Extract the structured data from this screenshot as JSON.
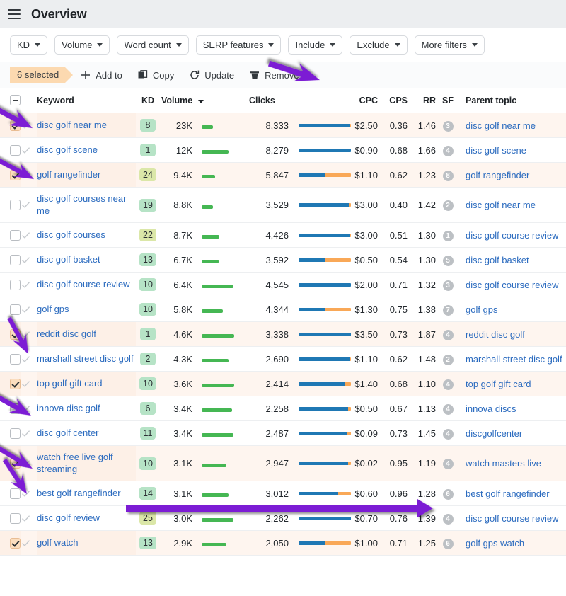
{
  "header": {
    "title": "Overview",
    "menu_icon": "hamburger-icon"
  },
  "filters": [
    {
      "label": "KD"
    },
    {
      "label": "Volume"
    },
    {
      "label": "Word count"
    },
    {
      "label": "SERP features"
    },
    {
      "label": "Include"
    },
    {
      "label": "Exclude"
    },
    {
      "label": "More filters"
    }
  ],
  "actionbar": {
    "selected_label": "6 selected",
    "add_to": "Add to",
    "copy": "Copy",
    "update": "Update",
    "remove": "Remove"
  },
  "table": {
    "columns": {
      "keyword": "Keyword",
      "kd": "KD",
      "volume": "Volume",
      "clicks": "Clicks",
      "cpc": "CPC",
      "cps": "CPS",
      "rr": "RR",
      "sf": "SF",
      "parent_topic": "Parent topic"
    },
    "sorted_by": "Volume",
    "rows": [
      {
        "selected": true,
        "keyword": "disc golf near me",
        "kd": 8,
        "kd_color": "#b6e3c6",
        "volume": "23K",
        "vol_pct": 26,
        "clicks": "8,333",
        "click_blue": 98,
        "click_orange": 2,
        "cpc": "$2.50",
        "cps": "0.36",
        "rr": "1.46",
        "sf": 3,
        "parent_topic": "disc golf near me"
      },
      {
        "selected": false,
        "keyword": "disc golf scene",
        "kd": 1,
        "kd_color": "#b6e3c6",
        "volume": "12K",
        "vol_pct": 62,
        "clicks": "8,279",
        "click_blue": 100,
        "click_orange": 0,
        "cpc": "$0.90",
        "cps": "0.68",
        "rr": "1.66",
        "sf": 4,
        "parent_topic": "disc golf scene"
      },
      {
        "selected": true,
        "keyword": "golf rangefinder",
        "kd": 24,
        "kd_color": "#dbe7a8",
        "volume": "9.4K",
        "vol_pct": 31,
        "clicks": "5,847",
        "click_blue": 50,
        "click_orange": 50,
        "cpc": "$1.10",
        "cps": "0.62",
        "rr": "1.23",
        "sf": 8,
        "parent_topic": "golf rangefinder"
      },
      {
        "selected": false,
        "keyword": "disc golf courses near me",
        "kd": 19,
        "kd_color": "#b6e3c6",
        "volume": "8.8K",
        "vol_pct": 26,
        "clicks": "3,529",
        "click_blue": 96,
        "click_orange": 4,
        "cpc": "$3.00",
        "cps": "0.40",
        "rr": "1.42",
        "sf": 2,
        "parent_topic": "disc golf near me"
      },
      {
        "selected": false,
        "keyword": "disc golf courses",
        "kd": 22,
        "kd_color": "#dbe7a8",
        "volume": "8.7K",
        "vol_pct": 40,
        "clicks": "4,426",
        "click_blue": 99,
        "click_orange": 1,
        "cpc": "$3.00",
        "cps": "0.51",
        "rr": "1.30",
        "sf": 1,
        "parent_topic": "disc golf course review"
      },
      {
        "selected": false,
        "keyword": "disc golf basket",
        "kd": 13,
        "kd_color": "#b6e3c6",
        "volume": "6.7K",
        "vol_pct": 39,
        "clicks": "3,592",
        "click_blue": 52,
        "click_orange": 48,
        "cpc": "$0.50",
        "cps": "0.54",
        "rr": "1.30",
        "sf": 5,
        "parent_topic": "disc golf basket"
      },
      {
        "selected": false,
        "keyword": "disc golf course review",
        "kd": 10,
        "kd_color": "#b6e3c6",
        "volume": "6.4K",
        "vol_pct": 72,
        "clicks": "4,545",
        "click_blue": 100,
        "click_orange": 0,
        "cpc": "$2.00",
        "cps": "0.71",
        "rr": "1.32",
        "sf": 3,
        "parent_topic": "disc golf course review"
      },
      {
        "selected": false,
        "keyword": "golf gps",
        "kd": 10,
        "kd_color": "#b6e3c6",
        "volume": "5.8K",
        "vol_pct": 48,
        "clicks": "4,344",
        "click_blue": 50,
        "click_orange": 50,
        "cpc": "$1.30",
        "cps": "0.75",
        "rr": "1.38",
        "sf": 7,
        "parent_topic": "golf gps"
      },
      {
        "selected": true,
        "keyword": "reddit disc golf",
        "kd": 1,
        "kd_color": "#b6e3c6",
        "volume": "4.6K",
        "vol_pct": 74,
        "clicks": "3,338",
        "click_blue": 100,
        "click_orange": 0,
        "cpc": "$3.50",
        "cps": "0.73",
        "rr": "1.87",
        "sf": 4,
        "parent_topic": "reddit disc golf"
      },
      {
        "selected": false,
        "keyword": "marshall street disc golf",
        "kd": 2,
        "kd_color": "#b6e3c6",
        "volume": "4.3K",
        "vol_pct": 62,
        "clicks": "2,690",
        "click_blue": 97,
        "click_orange": 3,
        "cpc": "$1.10",
        "cps": "0.62",
        "rr": "1.48",
        "sf": 2,
        "parent_topic": "marshall street disc golf"
      },
      {
        "selected": true,
        "keyword": "top golf gift card",
        "kd": 10,
        "kd_color": "#b6e3c6",
        "volume": "3.6K",
        "vol_pct": 74,
        "clicks": "2,414",
        "click_blue": 88,
        "click_orange": 12,
        "cpc": "$1.40",
        "cps": "0.68",
        "rr": "1.10",
        "sf": 4,
        "parent_topic": "top golf gift card"
      },
      {
        "selected": false,
        "keyword": "innova disc golf",
        "kd": 6,
        "kd_color": "#b6e3c6",
        "volume": "3.4K",
        "vol_pct": 70,
        "clicks": "2,258",
        "click_blue": 94,
        "click_orange": 6,
        "cpc": "$0.50",
        "cps": "0.67",
        "rr": "1.13",
        "sf": 4,
        "parent_topic": "innova discs"
      },
      {
        "selected": false,
        "keyword": "disc golf center",
        "kd": 11,
        "kd_color": "#b6e3c6",
        "volume": "3.4K",
        "vol_pct": 72,
        "clicks": "2,487",
        "click_blue": 92,
        "click_orange": 8,
        "cpc": "$0.09",
        "cps": "0.73",
        "rr": "1.45",
        "sf": 4,
        "parent_topic": "discgolfcenter"
      },
      {
        "selected": true,
        "keyword": "watch free live golf streaming",
        "kd": 10,
        "kd_color": "#b6e3c6",
        "volume": "3.1K",
        "vol_pct": 56,
        "clicks": "2,947",
        "click_blue": 94,
        "click_orange": 6,
        "cpc": "$0.02",
        "cps": "0.95",
        "rr": "1.19",
        "sf": 4,
        "parent_topic": "watch masters live"
      },
      {
        "selected": false,
        "keyword": "best golf rangefinder",
        "kd": 14,
        "kd_color": "#b6e3c6",
        "volume": "3.1K",
        "vol_pct": 62,
        "clicks": "3,012",
        "click_blue": 76,
        "click_orange": 24,
        "cpc": "$0.60",
        "cps": "0.96",
        "rr": "1.28",
        "sf": 6,
        "parent_topic": "best golf rangefinder"
      },
      {
        "selected": false,
        "keyword": "disc golf review",
        "kd": 25,
        "kd_color": "#dbe7a8",
        "volume": "3.0K",
        "vol_pct": 72,
        "clicks": "2,262",
        "click_blue": 100,
        "click_orange": 0,
        "cpc": "$0.70",
        "cps": "0.76",
        "rr": "1.39",
        "sf": 4,
        "parent_topic": "disc golf course review"
      },
      {
        "selected": true,
        "keyword": "golf watch",
        "kd": 13,
        "kd_color": "#b6e3c6",
        "volume": "2.9K",
        "vol_pct": 56,
        "clicks": "2,050",
        "click_blue": 50,
        "click_orange": 50,
        "cpc": "$1.00",
        "cps": "0.71",
        "rr": "1.25",
        "sf": 6,
        "parent_topic": "golf gps watch"
      }
    ]
  },
  "annotations": {
    "color": "#7b1fd4",
    "arrows": [
      {
        "name": "arrow-to-remove-button"
      },
      {
        "name": "arrow-to-row-1-checkbox"
      },
      {
        "name": "arrow-to-row-3-checkbox"
      },
      {
        "name": "arrow-to-row-9-checkbox"
      },
      {
        "name": "arrow-to-row-11-checkbox"
      },
      {
        "name": "arrow-to-row-13-checkbox"
      },
      {
        "name": "arrow-horizontal-row-14"
      }
    ]
  },
  "colors": {
    "accent_orange": "#fcd9b0",
    "link_blue": "#2b6bbf",
    "bar_green": "#45b753",
    "bar_blue": "#1f78b4",
    "bar_orange": "#f9a council"
  }
}
